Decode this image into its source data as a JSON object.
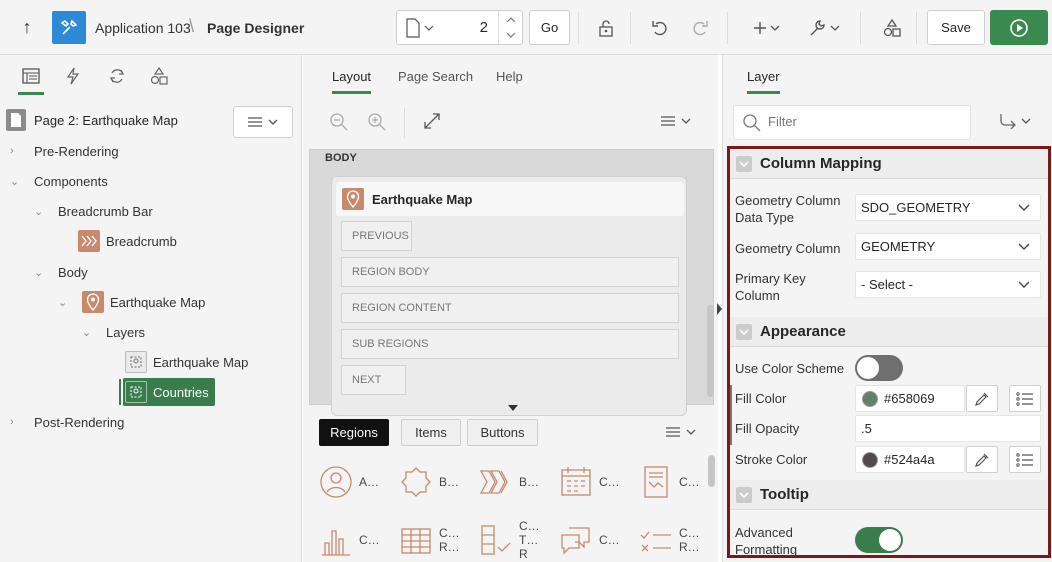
{
  "header": {
    "app_name": "Application 103",
    "separator": "\\",
    "page_name": "Page Designer",
    "page_number": "2",
    "go_label": "Go",
    "save_label": "Save"
  },
  "left_panel": {
    "page_title": "Page 2: Earthquake Map",
    "tree": {
      "pre_rendering": "Pre-Rendering",
      "components": "Components",
      "breadcrumb_bar": "Breadcrumb Bar",
      "breadcrumb": "Breadcrumb",
      "body": "Body",
      "earthquake_map": "Earthquake Map",
      "layers": "Layers",
      "layer_earthquake_map": "Earthquake Map",
      "layer_countries": "Countries",
      "post_rendering": "Post-Rendering"
    }
  },
  "middle_panel": {
    "tabs": [
      "Layout",
      "Page Search",
      "Help"
    ],
    "body_label": "BODY",
    "region_title": "Earthquake Map",
    "slots": [
      "PREVIOUS",
      "REGION BODY",
      "REGION CONTENT",
      "SUB REGIONS",
      "NEXT"
    ],
    "gallery_tabs": [
      "Regions",
      "Items",
      "Buttons"
    ],
    "gallery_row1": [
      "A…",
      "B…",
      "B…",
      "C…",
      "C…"
    ],
    "gallery_row2": [
      "C…",
      "C… R…",
      "C… T… R",
      "C…",
      "C… R…"
    ]
  },
  "right_panel": {
    "tab": "Layer",
    "filter_placeholder": "Filter",
    "column_mapping": {
      "title": "Column Mapping",
      "geometry_column_data_type_label": "Geometry Column Data Type",
      "geometry_column_data_type_value": "SDO_GEOMETRY",
      "geometry_column_label": "Geometry Column",
      "geometry_column_value": "GEOMETRY",
      "primary_key_column_label": "Primary Key Column",
      "primary_key_column_value": "- Select -"
    },
    "appearance": {
      "title": "Appearance",
      "use_color_scheme_label": "Use Color Scheme",
      "use_color_scheme_on": false,
      "fill_color_label": "Fill Color",
      "fill_color_value": "#658069",
      "fill_opacity_label": "Fill Opacity",
      "fill_opacity_value": ".5",
      "stroke_color_label": "Stroke Color",
      "stroke_color_value": "#524a4a"
    },
    "tooltip": {
      "title": "Tooltip",
      "advanced_formatting_label": "Advanced Formatting",
      "advanced_formatting_on": true
    }
  },
  "colors": {
    "accent_green": "#3a8a4f",
    "selection_green": "#3a7d4c",
    "app_blue": "#2f8ad6",
    "region_icon": "#c78a6c",
    "highlight_border": "#7b1818"
  }
}
